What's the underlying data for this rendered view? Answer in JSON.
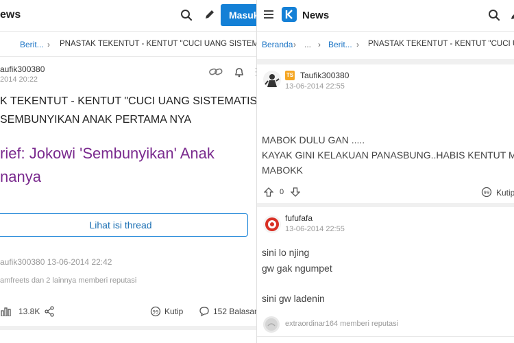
{
  "left": {
    "header": {
      "title": "ews",
      "login_label": "Masuk"
    },
    "breadcrumb": {
      "item1": "Berit...",
      "item2": "...",
      "current": "PNASTAK TEKENTUT - KENTUT \"CUCI UANG SISTEMATI..."
    },
    "author": {
      "name": "aufik300380",
      "time": "2014 20:22"
    },
    "thread_title": [
      "K TEKENTUT - KENTUT \"CUCI UANG SISTEMATIS \"",
      "SEMBUNYIKAN ANAK PERTAMA NYA"
    ],
    "headline": [
      "rief: Jokowi 'Sembunyikan' Anak",
      "nanya"
    ],
    "view_thread_label": "Lihat isi thread",
    "edit_meta": "aufik300380 13-06-2014 22:42",
    "reputation": "amfreets dan 2 lainnya memberi reputasi",
    "stats": {
      "views": "13.8K",
      "quote": "Kutip",
      "replies": "152 Balasan"
    }
  },
  "right": {
    "header": {
      "title": "News"
    },
    "breadcrumb": {
      "home": "Beranda",
      "dots": "...",
      "item": "Berit...",
      "current": "PNASTAK TEKENTUT - KENTUT \"CUCI UANG"
    },
    "post1": {
      "badge": "TS",
      "user": "Taufik300380",
      "time": "13-06-2014 22:55",
      "lines": [
        "MABOK DULU GAN .....",
        "KAYAK GINI KELAKUAN PANASBUNG..HABIS KENTUT M",
        "MABOKK"
      ],
      "vote_count": "0",
      "quote": "Kutip"
    },
    "post2": {
      "user": "fufufafa",
      "time": "13-06-2014 22:55",
      "lines": [
        "sini lo njing",
        "gw gak ngumpet",
        "",
        "sini gw ladenin"
      ],
      "reputation": "extraordinar164 memberi reputasi"
    }
  },
  "colors": {
    "accent": "#1480d6",
    "headline": "#7a2a8e",
    "link": "#1b74c5"
  }
}
